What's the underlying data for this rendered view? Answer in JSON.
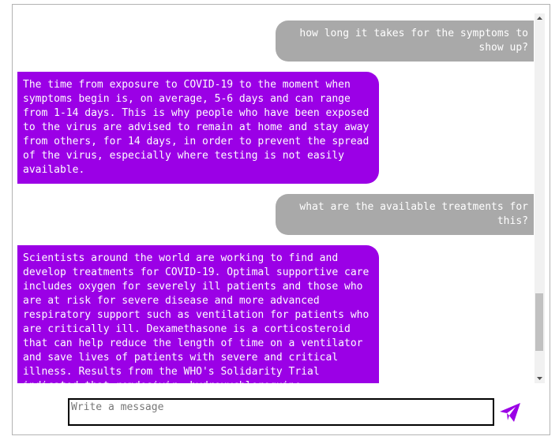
{
  "messages": [
    {
      "role": "user",
      "text": "how long it takes for the symptoms to show up?"
    },
    {
      "role": "bot",
      "text": "The time from exposure to COVID-19 to the moment when symptoms begin is, on average, 5-6 days and can range from 1-14 days. This is why people who have been exposed to the virus are advised to remain at home and stay away from others, for 14 days, in order to prevent the spread of the virus, especially where testing is not easily available."
    },
    {
      "role": "user",
      "text": "what are the available treatments for this?"
    },
    {
      "role": "bot",
      "text": "Scientists around the world are working to find and develop treatments for COVID-19. Optimal supportive care includes oxygen for severely ill patients and those who are at risk for severe disease and more advanced respiratory support such as ventilation for patients who are critically ill. Dexamethasone is a corticosteroid that can help reduce the length of time on a ventilator and save lives of patients with severe and critical illness. Results from the WHO's Solidarity Trial indicated that remdesivir, hydroxychloroquine"
    }
  ],
  "composer": {
    "placeholder": "Write a message",
    "value": ""
  },
  "icons": {
    "send": "send-paper-plane-icon",
    "scroll_up": "chevron-up-icon",
    "scroll_down": "chevron-down-icon"
  },
  "colors": {
    "user_bubble": "#a9a9a9",
    "bot_bubble": "#9b00e6",
    "send_icon": "#9b00e6"
  }
}
